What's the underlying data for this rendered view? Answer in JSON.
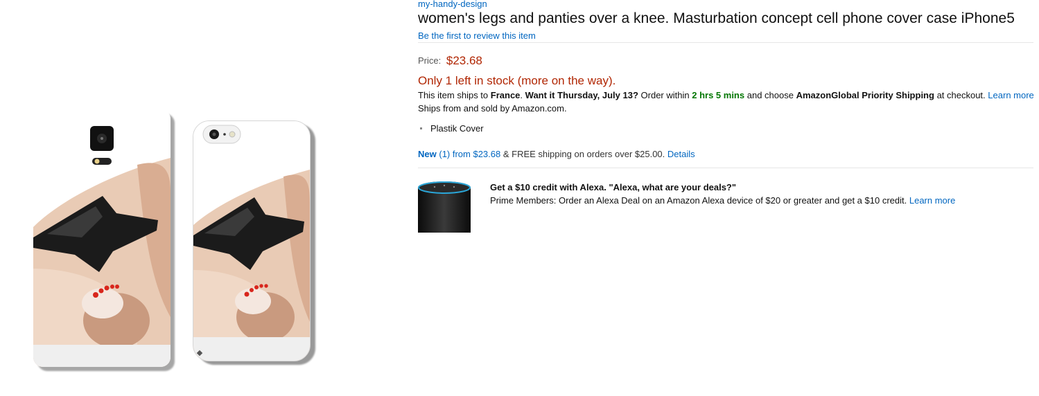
{
  "product": {
    "brand": "my-handy-design",
    "title": "women's legs and panties over a knee. Masturbation concept cell phone cover case iPhone5",
    "review_link": "Be the first to review this item",
    "bullets": [
      "Plastik Cover"
    ]
  },
  "price": {
    "label": "Price:",
    "value": "$23.68"
  },
  "availability": {
    "stock": "Only 1 left in stock (more on the way).",
    "ships_prefix": "This item ships to",
    "ships_country": "France",
    "want_it": "Want it Thursday, July 13?",
    "order_within": "Order within",
    "time_left": "2 hrs 5 mins",
    "and_choose": "and choose",
    "shipping_method": "AmazonGlobal Priority Shipping",
    "at_checkout": "at checkout.",
    "learn_more": "Learn more",
    "sold_by": "Ships from and sold by Amazon.com."
  },
  "offers": {
    "new_label": "New",
    "count_from": "(1) from $23.68",
    "shipping_note": "& FREE shipping on orders over $25.00.",
    "details_link": "Details"
  },
  "promo": {
    "headline": "Get a $10 credit with Alexa. \"Alexa, what are your deals?\"",
    "body": "Prime Members: Order an Alexa Deal on an Amazon Alexa device of $20 or greater and get a $10 credit.",
    "learn_more": "Learn more"
  },
  "colors": {
    "link": "#0066c0",
    "price": "#b12704",
    "green": "#007600"
  },
  "icons": [
    "product-image",
    "alexa-echo-image"
  ]
}
